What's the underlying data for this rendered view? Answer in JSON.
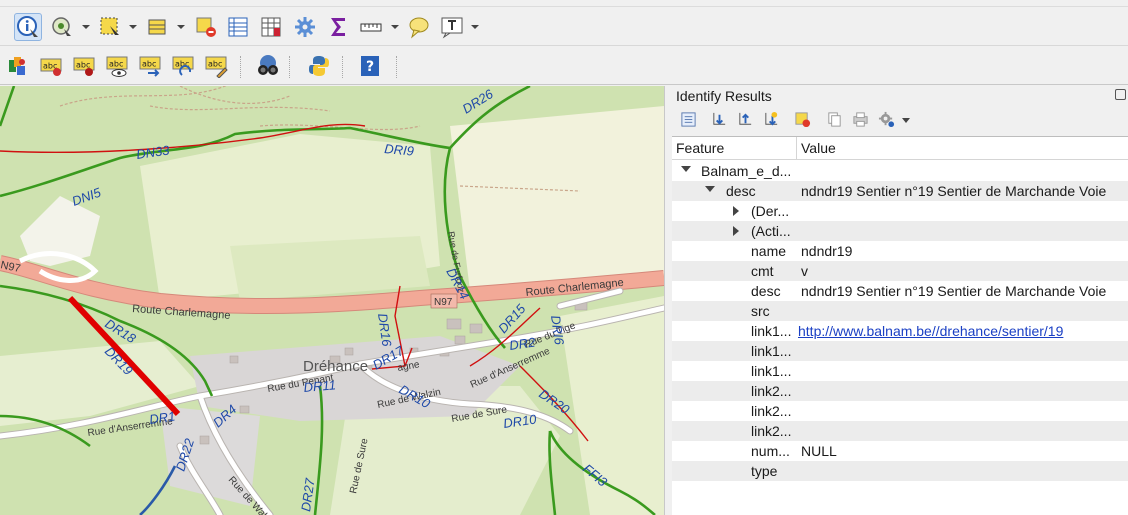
{
  "toolbar1": {
    "icons": [
      "identify-icon",
      "action-icon",
      "select-icon",
      "attribute-table-select-icon",
      "deselect-icon",
      "open-table-icon",
      "field-calculator-icon",
      "processing-gear-icon",
      "statistics-sigma-icon",
      "measure-icon",
      "map-tip-icon",
      "text-annotation-icon"
    ]
  },
  "toolbar2": {
    "icons": [
      "layer-style-icon",
      "label-icon",
      "label-pin-icon",
      "label-show-icon",
      "label-move-icon",
      "label-rotate-icon",
      "label-change-icon",
      "binoculars-icon",
      "python-icon",
      "help-icon"
    ]
  },
  "map": {
    "trail_labels": [
      "DR26",
      "DN33",
      "DRI9",
      "DNI5",
      "DR14",
      "DR18",
      "DR19",
      "DR16",
      "DR17",
      "DR15",
      "DR2",
      "DRI6",
      "DR11",
      "DR10",
      "DR20",
      "DR4",
      "DR1",
      "DR22",
      "DR10",
      "FFI3",
      "DR27"
    ],
    "road_labels": [
      "Route Charlemagne",
      "Route Charlemagne",
      "N97",
      "agne",
      "Rue du Tige",
      "Rue du Penant",
      "Rue d'Anserremme",
      "Rue d'Anserremme",
      "Rue de Walzin",
      "Rue de Sure",
      "Rue de Sure",
      "Rue de Walzin",
      "Rue de Furfooz",
      "Rue de la Tige"
    ],
    "place_label": "Dréhance",
    "colors": {
      "trail": "#3a9a1e",
      "highlight": "#e00000",
      "road_main": "#eea493",
      "forest": "#cfe2b0",
      "meadow": "#eef2d5",
      "label": "#1f49a8"
    }
  },
  "identify": {
    "title": "Identify Results",
    "columns": {
      "feature": "Feature",
      "value": "Value"
    },
    "rows": [
      {
        "key": "Balnam_e_d...",
        "value": ""
      },
      {
        "key": "desc",
        "value": "ndndr19 Sentier n°19 Sentier de Marchande Voie"
      },
      {
        "key": "(Der...",
        "value": ""
      },
      {
        "key": "(Acti...",
        "value": ""
      },
      {
        "key": "name",
        "value": "ndndr19"
      },
      {
        "key": "cmt",
        "value": "v"
      },
      {
        "key": "desc",
        "value": "ndndr19 Sentier n°19 Sentier de Marchande Voie"
      },
      {
        "key": "src",
        "value": ""
      },
      {
        "key": "link1...",
        "value": "http://www.balnam.be//drehance/sentier/19"
      },
      {
        "key": "link1...",
        "value": ""
      },
      {
        "key": "link1...",
        "value": ""
      },
      {
        "key": "link2...",
        "value": ""
      },
      {
        "key": "link2...",
        "value": ""
      },
      {
        "key": "link2...",
        "value": ""
      },
      {
        "key": "num...",
        "value": "NULL"
      },
      {
        "key": "type",
        "value": ""
      }
    ]
  }
}
